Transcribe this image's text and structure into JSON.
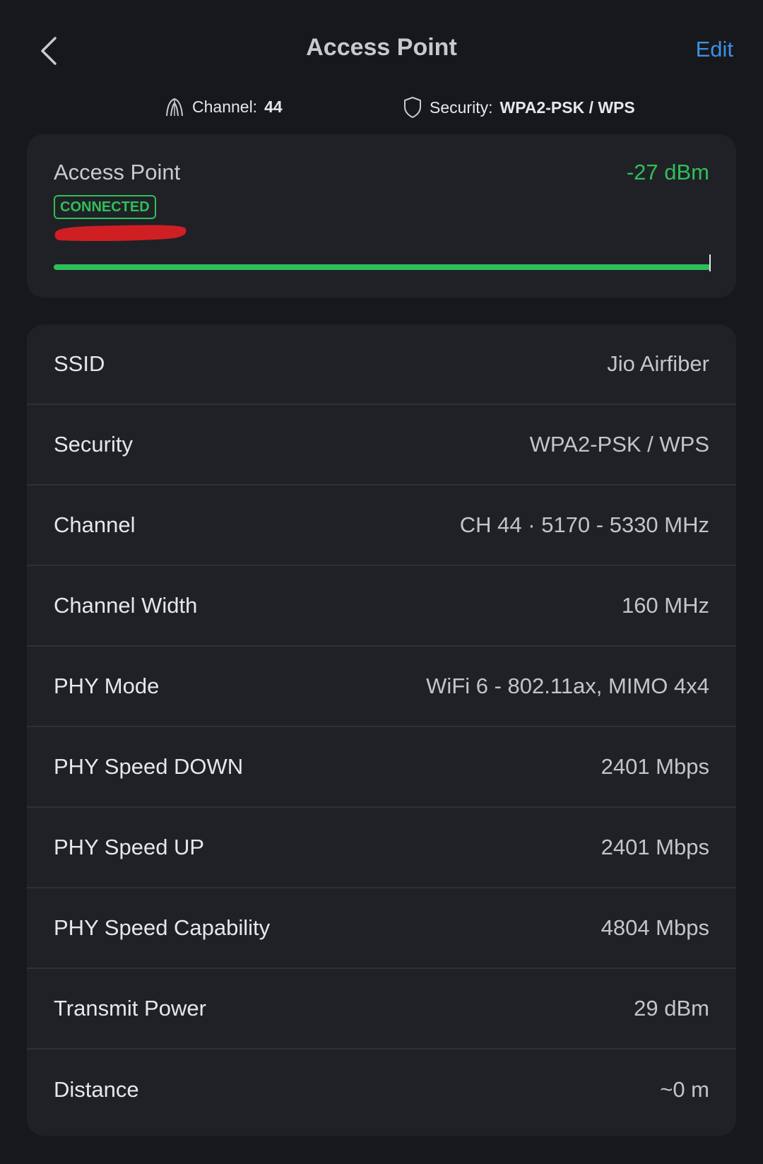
{
  "header": {
    "back_icon": "chevron-left-icon",
    "title": "Access Point",
    "edit_label": "Edit",
    "edit_color": "#3d8fe6"
  },
  "summary": {
    "channel_icon": "antenna-icon",
    "channel_label": "Channel:",
    "channel_value": "44",
    "security_icon": "shield-icon",
    "security_label": "Security:",
    "security_value": "WPA2-PSK / WPS"
  },
  "access_point": {
    "name": "Access Point",
    "rssi": "-27 dBm",
    "status": "CONNECTED",
    "status_color": "#2fbf5a",
    "signal_level_percent": 100
  },
  "details": [
    {
      "label": "SSID",
      "value": "Jio Airfiber"
    },
    {
      "label": "Security",
      "value": "WPA2-PSK / WPS"
    },
    {
      "label": "Channel",
      "value": "CH 44 · 5170 - 5330 MHz"
    },
    {
      "label": "Channel Width",
      "value": "160 MHz"
    },
    {
      "label": "PHY Mode",
      "value": "WiFi 6 - 802.11ax, MIMO 4x4"
    },
    {
      "label": "PHY Speed DOWN",
      "value": "2401 Mbps"
    },
    {
      "label": "PHY Speed UP",
      "value": "2401 Mbps"
    },
    {
      "label": "PHY Speed Capability",
      "value": "4804 Mbps"
    },
    {
      "label": "Transmit Power",
      "value": "29 dBm"
    },
    {
      "label": "Distance",
      "value": "~0 m"
    }
  ]
}
